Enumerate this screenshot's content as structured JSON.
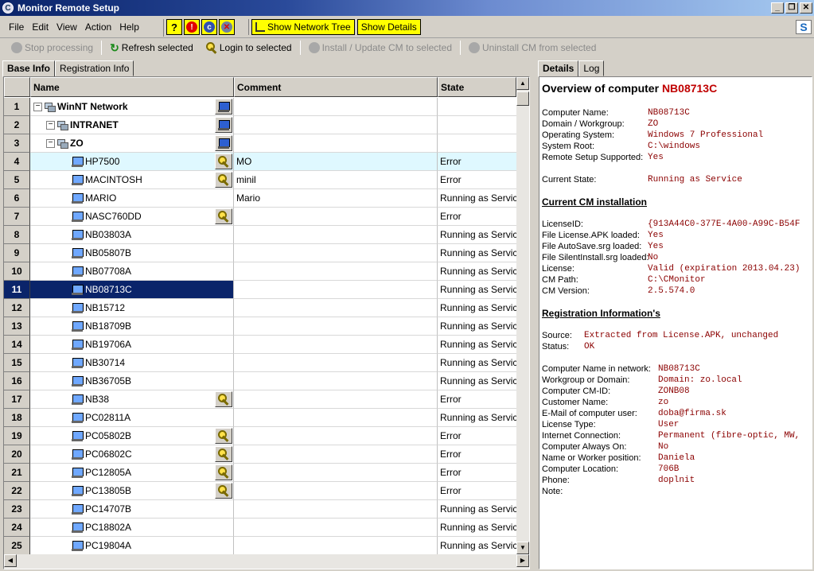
{
  "window": {
    "title": "Monitor Remote Setup",
    "app_icon": "C",
    "min": "_",
    "max": "❐",
    "close": "✕"
  },
  "menu": [
    "File",
    "Edit",
    "View",
    "Action",
    "Help"
  ],
  "icon_toolbar": {
    "help": "?",
    "alert": "!",
    "cm": "c",
    "cancel": "✕"
  },
  "toggle_buttons": {
    "network_tree": "Show Network Tree",
    "details": "Show Details"
  },
  "brand": "S",
  "actions": {
    "stop": "Stop processing",
    "refresh": "Refresh selected",
    "login": "Login to selected",
    "install": "Install / Update CM to selected",
    "uninstall": "Uninstall CM from selected"
  },
  "left_tabs": [
    "Base Info",
    "Registration Info"
  ],
  "right_tabs": [
    "Details",
    "Log"
  ],
  "grid": {
    "columns": [
      "Name",
      "Comment",
      "State"
    ],
    "rows": [
      {
        "n": "1",
        "name": "WinNT Network",
        "comment": "",
        "state": "",
        "level": 0,
        "kind": "network",
        "action": "pc"
      },
      {
        "n": "2",
        "name": "INTRANET",
        "comment": "",
        "state": "",
        "level": 1,
        "kind": "network",
        "action": "pc"
      },
      {
        "n": "3",
        "name": "ZO",
        "comment": "",
        "state": "",
        "level": 1,
        "kind": "network",
        "action": "pc"
      },
      {
        "n": "4",
        "name": "HP7500",
        "comment": "MO",
        "state": "Error",
        "level": 2,
        "kind": "pc",
        "action": "key",
        "highlight": true
      },
      {
        "n": "5",
        "name": "MACINTOSH",
        "comment": "minil",
        "state": "Error",
        "level": 2,
        "kind": "pc",
        "action": "key"
      },
      {
        "n": "6",
        "name": "MARIO",
        "comment": "Mario",
        "state": "Running as Service",
        "level": 2,
        "kind": "pc",
        "action": ""
      },
      {
        "n": "7",
        "name": "NASC760DD",
        "comment": "",
        "state": "Error",
        "level": 2,
        "kind": "pc",
        "action": "key"
      },
      {
        "n": "8",
        "name": "NB03803A",
        "comment": "",
        "state": "Running as Service",
        "level": 2,
        "kind": "pc",
        "action": ""
      },
      {
        "n": "9",
        "name": "NB05807B",
        "comment": "",
        "state": "Running as Service",
        "level": 2,
        "kind": "pc",
        "action": ""
      },
      {
        "n": "10",
        "name": "NB07708A",
        "comment": "",
        "state": "Running as Service",
        "level": 2,
        "kind": "pc",
        "action": ""
      },
      {
        "n": "11",
        "name": "NB08713C",
        "comment": "",
        "state": "Running as Service",
        "level": 2,
        "kind": "pc",
        "action": "",
        "selected": true
      },
      {
        "n": "12",
        "name": "NB15712",
        "comment": "",
        "state": "Running as Service",
        "level": 2,
        "kind": "pc",
        "action": ""
      },
      {
        "n": "13",
        "name": "NB18709B",
        "comment": "",
        "state": "Running as Service",
        "level": 2,
        "kind": "pc",
        "action": ""
      },
      {
        "n": "14",
        "name": "NB19706A",
        "comment": "",
        "state": "Running as Service",
        "level": 2,
        "kind": "pc",
        "action": ""
      },
      {
        "n": "15",
        "name": "NB30714",
        "comment": "",
        "state": "Running as Service",
        "level": 2,
        "kind": "pc",
        "action": ""
      },
      {
        "n": "16",
        "name": "NB36705B",
        "comment": "",
        "state": "Running as Service",
        "level": 2,
        "kind": "pc",
        "action": ""
      },
      {
        "n": "17",
        "name": "NB38",
        "comment": "",
        "state": "Error",
        "level": 2,
        "kind": "pc",
        "action": "key"
      },
      {
        "n": "18",
        "name": "PC02811A",
        "comment": "",
        "state": "Running as Service",
        "level": 2,
        "kind": "pc",
        "action": ""
      },
      {
        "n": "19",
        "name": "PC05802B",
        "comment": "",
        "state": "Error",
        "level": 2,
        "kind": "pc",
        "action": "key"
      },
      {
        "n": "20",
        "name": "PC06802C",
        "comment": "",
        "state": "Error",
        "level": 2,
        "kind": "pc",
        "action": "key"
      },
      {
        "n": "21",
        "name": "PC12805A",
        "comment": "",
        "state": "Error",
        "level": 2,
        "kind": "pc",
        "action": "key"
      },
      {
        "n": "22",
        "name": "PC13805B",
        "comment": "",
        "state": "Error",
        "level": 2,
        "kind": "pc",
        "action": "key"
      },
      {
        "n": "23",
        "name": "PC14707B",
        "comment": "",
        "state": "Running as Service",
        "level": 2,
        "kind": "pc",
        "action": ""
      },
      {
        "n": "24",
        "name": "PC18802A",
        "comment": "",
        "state": "Running as Service",
        "level": 2,
        "kind": "pc",
        "action": ""
      },
      {
        "n": "25",
        "name": "PC19804A",
        "comment": "",
        "state": "Running as Service",
        "level": 2,
        "kind": "pc",
        "action": ""
      }
    ]
  },
  "details": {
    "heading_prefix": "Overview of computer ",
    "heading_name": "NB08713C",
    "basic": [
      [
        "Computer Name:",
        "NB08713C"
      ],
      [
        "Domain / Workgroup:",
        "ZO"
      ],
      [
        "Operating System:",
        "Windows 7 Professional"
      ],
      [
        "System Root:",
        "C:\\windows"
      ],
      [
        "Remote Setup Supported:",
        "Yes"
      ]
    ],
    "current_state": [
      "Current State:",
      "Running as Service"
    ],
    "cm_heading": "Current CM installation",
    "cm": [
      [
        "LicenseID:",
        "{913A44C0-377E-4A00-A99C-B54F"
      ],
      [
        "File License.APK loaded:",
        "Yes"
      ],
      [
        "File AutoSave.srg loaded:",
        "Yes"
      ],
      [
        "File SilentInstall.srg loaded:",
        "No"
      ],
      [
        "License:",
        "Valid (expiration 2013.04.23)"
      ],
      [
        "CM Path:",
        "C:\\CMonitor"
      ],
      [
        "CM Version:",
        "2.5.574.0"
      ]
    ],
    "reg_heading": "Registration Information's",
    "reg_status": [
      [
        "Source:",
        "Extracted from License.APK, unchanged"
      ],
      [
        "Status:",
        "OK"
      ]
    ],
    "reg": [
      [
        "Computer Name in network:",
        "NB08713C"
      ],
      [
        "Workgroup or Domain:",
        "Domain: zo.local"
      ],
      [
        "Computer CM-ID:",
        "ZONB08"
      ],
      [
        "Customer Name:",
        "zo"
      ],
      [
        "E-Mail of computer user:",
        "doba@firma.sk"
      ],
      [
        "License Type:",
        "User"
      ],
      [
        "Internet Connection:",
        "Permanent (fibre-optic, MW,"
      ],
      [
        "Computer Always On:",
        "No"
      ],
      [
        "Name or Worker position:",
        "Daniela"
      ],
      [
        "Computer Location:",
        "706B"
      ],
      [
        "Phone:",
        "doplnit"
      ],
      [
        "Note:",
        ""
      ]
    ]
  },
  "scroll": {
    "up": "▲",
    "down": "▼",
    "left": "◀",
    "right": "▶"
  }
}
